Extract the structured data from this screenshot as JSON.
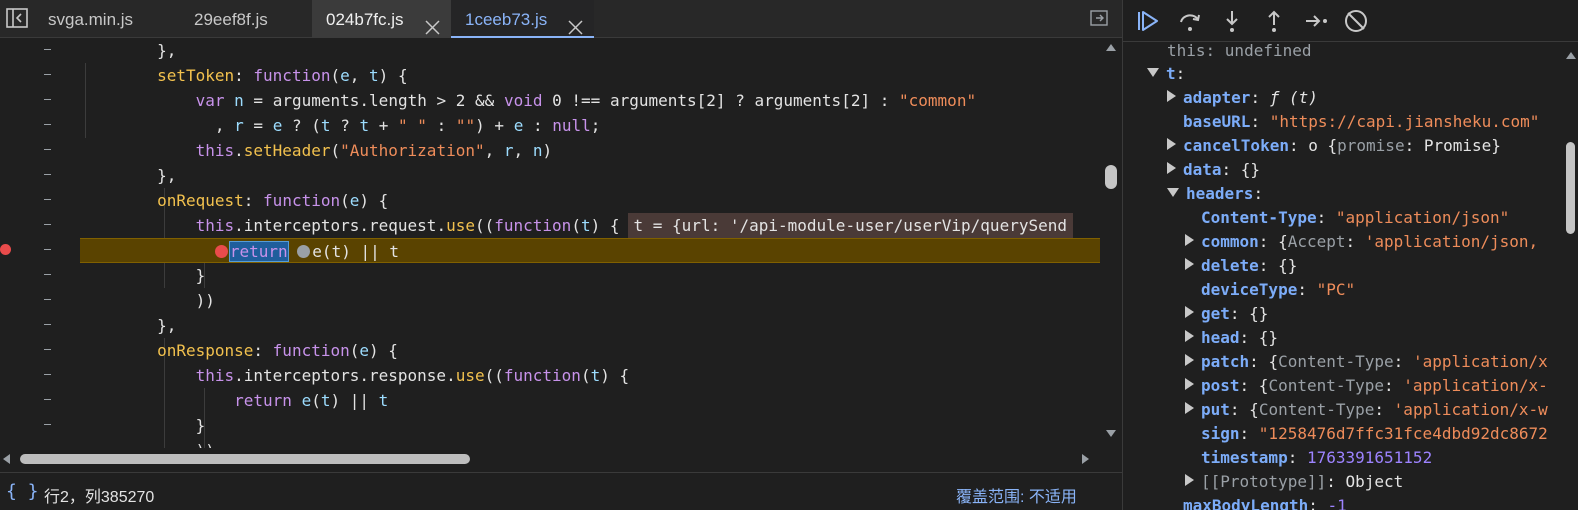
{
  "tabs": [
    {
      "label": "svga.min.js",
      "state": "normal",
      "closable": false
    },
    {
      "label": "29eef8f.js",
      "state": "normal",
      "closable": false
    },
    {
      "label": "024b7fc.js",
      "state": "active",
      "closable": true
    },
    {
      "label": "1ceeb73.js",
      "state": "selected",
      "closable": true
    }
  ],
  "gutter": {
    "line_marker": "-",
    "breakpoint_color": "#e94b4b"
  },
  "code_lines": [
    "        },",
    "        setToken: function(e, t) {",
    "            var n = arguments.length > 2 && void 0 !== arguments[2] ? arguments[2] : \"common\"",
    "              , r = e ? (t ? t + \" \" : \"\") + e : null;",
    "            this.setHeader(\"Authorization\", r, n)",
    "        },",
    "        onRequest: function(e) {",
    "            this.interceptors.request.use((function(t) {",
    "                return e(t) || t",
    "            }",
    "            ))",
    "        },",
    "        onResponse: function(e) {",
    "            this.interceptors.response.use((function(t) {",
    "                return e(t) || t",
    "            }",
    "            ))"
  ],
  "inline_value": "t = {url: '/api-module-user/userVip/querySend",
  "status": {
    "braces": "{ }",
    "position": "行2，列385270",
    "coverage": "覆盖范围: 不适用"
  },
  "debugger_toolbar": [
    {
      "name": "resume-icon",
      "label": "Resume script execution"
    },
    {
      "name": "step-over-icon",
      "label": "Step over next function call"
    },
    {
      "name": "step-into-icon",
      "label": "Step into next function call"
    },
    {
      "name": "step-out-icon",
      "label": "Step out of current function"
    },
    {
      "name": "step-icon",
      "label": "Step"
    },
    {
      "name": "deactivate-breakpoints-icon",
      "label": "Deactivate breakpoints"
    }
  ],
  "scope": {
    "this_row": {
      "key": "this",
      "value": "undefined"
    },
    "t_key": "t",
    "entries": [
      {
        "indent": 1,
        "expand": "r",
        "key": "adapter",
        "value": "ƒ (t)",
        "vclass": "it"
      },
      {
        "indent": 1,
        "expand": "",
        "key": "baseURL",
        "value": "\"https://capi.jiansheku.com\"",
        "vclass": "sv"
      },
      {
        "indent": 1,
        "expand": "r",
        "key": "cancelToken",
        "value_prefix": "o ",
        "value": "{promise: Promise}",
        "vclass": "wh"
      },
      {
        "indent": 1,
        "expand": "r",
        "key": "data",
        "value": "{}",
        "vclass": "wh"
      },
      {
        "indent": 1,
        "expand": "d",
        "key": "headers",
        "value": "",
        "vclass": "wh"
      },
      {
        "indent": 2,
        "expand": "",
        "key": "Content-Type",
        "value": "\"application/json\"",
        "vclass": "sv"
      },
      {
        "indent": 2,
        "expand": "r",
        "key": "common",
        "value": "{Accept: 'application/json,",
        "vclass": "mixed"
      },
      {
        "indent": 2,
        "expand": "r",
        "key": "delete",
        "value": "{}",
        "vclass": "wh"
      },
      {
        "indent": 2,
        "expand": "",
        "key": "deviceType",
        "value": "\"PC\"",
        "vclass": "sv"
      },
      {
        "indent": 2,
        "expand": "r",
        "key": "get",
        "value": "{}",
        "vclass": "wh"
      },
      {
        "indent": 2,
        "expand": "r",
        "key": "head",
        "value": "{}",
        "vclass": "wh"
      },
      {
        "indent": 2,
        "expand": "r",
        "key": "patch",
        "value": "{Content-Type: 'application/x",
        "vclass": "mixed"
      },
      {
        "indent": 2,
        "expand": "r",
        "key": "post",
        "value": "{Content-Type: 'application/x-",
        "vclass": "mixed"
      },
      {
        "indent": 2,
        "expand": "r",
        "key": "put",
        "value": "{Content-Type: 'application/x-w",
        "vclass": "mixed"
      },
      {
        "indent": 2,
        "expand": "",
        "key": "sign",
        "value": "\"1258476d7ffc31fce4dbd92dc8672",
        "vclass": "sv"
      },
      {
        "indent": 2,
        "expand": "",
        "key": "timestamp",
        "value": "1763391651152",
        "vclass": "nv"
      },
      {
        "indent": 2,
        "expand": "r",
        "key": "[[Prototype]]",
        "value": "Object",
        "vclass": "wh",
        "dimkey": true
      },
      {
        "indent": 1,
        "expand": "",
        "key": "maxBodyLength",
        "value": "-1",
        "vclass": "nv"
      }
    ]
  }
}
